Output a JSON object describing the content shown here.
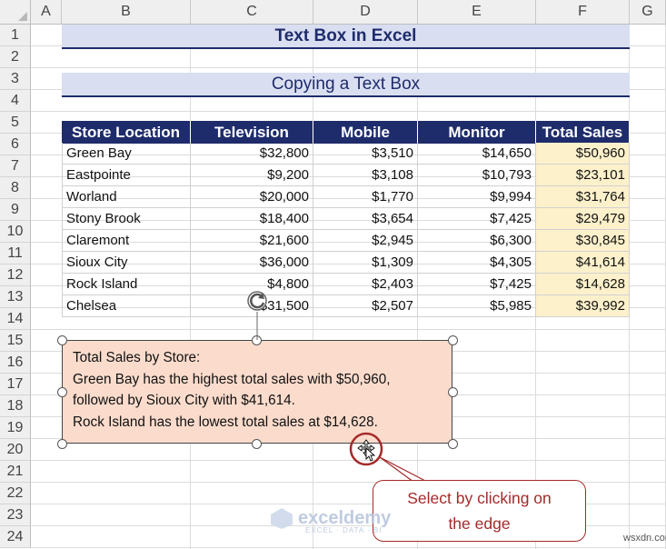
{
  "columns": [
    "A",
    "B",
    "C",
    "D",
    "E",
    "F",
    "G"
  ],
  "rows": [
    "1",
    "2",
    "3",
    "4",
    "5",
    "6",
    "7",
    "8",
    "9",
    "10",
    "11",
    "12",
    "13",
    "14",
    "15",
    "16",
    "17",
    "18",
    "19",
    "20",
    "21",
    "22",
    "23",
    "24"
  ],
  "title": "Text Box in Excel",
  "subtitle": "Copying a Text Box",
  "table": {
    "headers": [
      "Store Location",
      "Television",
      "Mobile",
      "Monitor",
      "Total Sales"
    ],
    "rows": [
      [
        "Green Bay",
        "$32,800",
        "$3,510",
        "$14,650",
        "$50,960"
      ],
      [
        "Eastpointe",
        "$9,200",
        "$3,108",
        "$10,793",
        "$23,101"
      ],
      [
        "Worland",
        "$20,000",
        "$1,770",
        "$9,994",
        "$31,764"
      ],
      [
        "Stony Brook",
        "$18,400",
        "$3,654",
        "$7,425",
        "$29,479"
      ],
      [
        "Claremont",
        "$21,600",
        "$2,945",
        "$6,300",
        "$30,845"
      ],
      [
        "Sioux City",
        "$36,000",
        "$1,309",
        "$4,305",
        "$41,614"
      ],
      [
        "Rock Island",
        "$4,800",
        "$2,403",
        "$7,425",
        "$14,628"
      ],
      [
        "Chelsea",
        "$31,500",
        "$2,507",
        "$5,985",
        "$39,992"
      ]
    ]
  },
  "textbox": {
    "lines": [
      "Total Sales by Store:",
      "Green Bay has the highest total sales with $50,960,",
      "followed by Sioux City with $41,614.",
      "Rock Island has the lowest total sales at $14,628."
    ]
  },
  "callout": {
    "line1": "Select by clicking on",
    "line2": "the edge"
  },
  "watermark": {
    "brand": "exceldemy",
    "tagline": "EXCEL · DATA · BI"
  },
  "site": "wsxdn.com",
  "colors": {
    "header_fill": "#1f2c6b",
    "title_fill": "#d9dff1",
    "total_fill": "#fdf1cb",
    "textbox_fill": "#fbdccc",
    "callout_color": "#a52a2a"
  },
  "icons": [
    "rotate-handle-icon",
    "move-cursor-icon"
  ]
}
